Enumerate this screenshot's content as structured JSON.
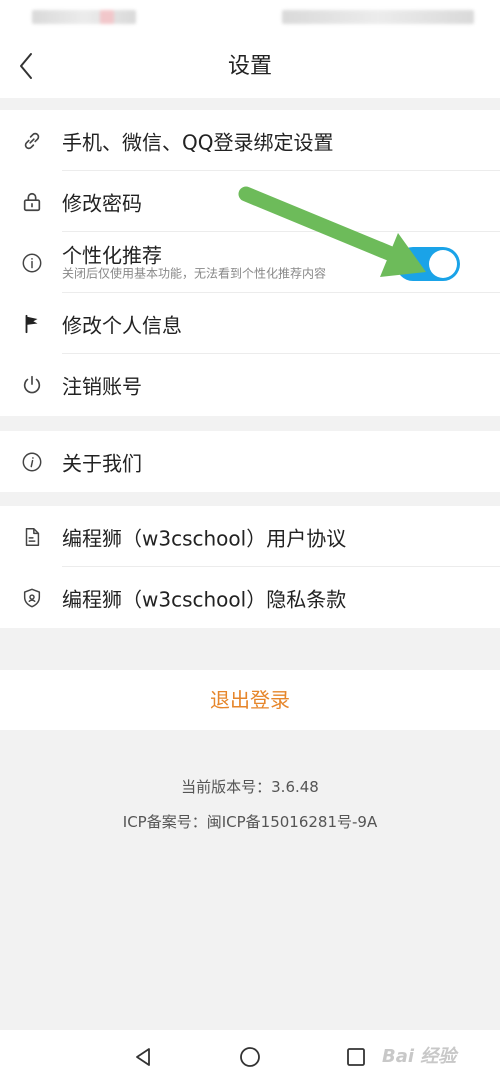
{
  "header": {
    "title": "设置"
  },
  "group1": [
    {
      "label": "手机、微信、QQ登录绑定设置",
      "icon": "link-icon"
    },
    {
      "label": "修改密码",
      "icon": "lock-icon"
    },
    {
      "label": "个性化推荐",
      "subtitle": "关闭后仅使用基本功能，无法看到个性化推荐内容",
      "icon": "info-circle-icon",
      "toggle_on": true
    },
    {
      "label": "修改个人信息",
      "icon": "flag-icon"
    },
    {
      "label": "注销账号",
      "icon": "power-icon"
    }
  ],
  "group2": [
    {
      "label": "关于我们",
      "icon": "info-italic-icon"
    }
  ],
  "group3": [
    {
      "label": "编程狮（w3cschool）用户协议",
      "icon": "document-icon"
    },
    {
      "label": "编程狮（w3cschool）隐私条款",
      "icon": "shield-icon"
    }
  ],
  "logout_label": "退出登录",
  "version_text": "当前版本号：3.6.48",
  "icp_text": "ICP备案号：闽ICP备15016281号-9A",
  "watermark": "Bai 经验",
  "colors": {
    "accent": "#e6862b",
    "toggle": "#1aa3e8",
    "arrow": "#6dbb5a"
  }
}
